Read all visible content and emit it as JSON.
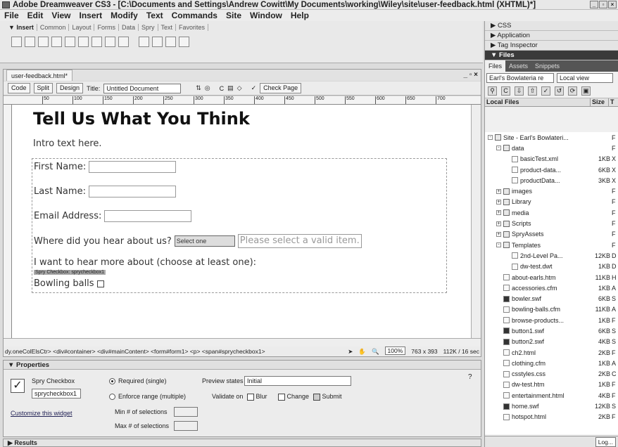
{
  "window": {
    "title": "Adobe Dreamweaver CS3 - [C:\\Documents and Settings\\Andrew Cowitt\\My Documents\\working\\Wiley\\site\\user-feedback.html (XHTML)*]"
  },
  "menu": [
    "File",
    "Edit",
    "View",
    "Insert",
    "Modify",
    "Text",
    "Commands",
    "Site",
    "Window",
    "Help"
  ],
  "insert_bar": {
    "label": "▼ Insert",
    "tabs": [
      "Common",
      "Layout",
      "Forms",
      "Data",
      "Spry",
      "Text",
      "Favorites"
    ]
  },
  "document": {
    "tab": "user-feedback.html*",
    "toolbar": {
      "code": "Code",
      "split": "Split",
      "design": "Design",
      "title_label": "Title:",
      "title_value": "Untitled Document",
      "check_page": "Check Page"
    },
    "ruler_labels": [
      "50",
      "100",
      "150",
      "200",
      "250",
      "300",
      "350",
      "400",
      "450",
      "500",
      "550",
      "600",
      "650",
      "700"
    ],
    "content": {
      "heading": "Tell Us What You Think",
      "intro": "Intro text here.",
      "first_name": "First Name:",
      "last_name": "Last Name:",
      "email": "Email Address:",
      "hear_about": "Where did you hear about us?",
      "select_value": "Select one",
      "select_error": "Please select a valid item.",
      "hear_more": "I want to hear more about (choose at least one):",
      "spry_label": "Spry Checkbox: sprycheckbox1",
      "bowling": "Bowling balls"
    },
    "status": {
      "tags": "dy.oneColElsCtr> <div#container> <div#mainContent> <form#form1> <p> <span#sprycheckbox1>",
      "zoom": "100%",
      "dims": "763 x 393",
      "size": "112K / 16 sec"
    }
  },
  "properties": {
    "header": "▼ Properties",
    "widget_type": "Spry Checkbox",
    "widget_id": "sprycheckbox1",
    "required": "Required (single)",
    "enforce": "Enforce range (multiple)",
    "min_label": "Min # of selections",
    "max_label": "Max # of selections",
    "preview_label": "Preview states",
    "preview_value": "Initial",
    "validate_label": "Validate on",
    "blur": "Blur",
    "change": "Change",
    "submit": "Submit",
    "customize": "Customize this widget"
  },
  "results": "▶ Results",
  "right_panel": {
    "css": "▶ CSS",
    "application": "▶ Application",
    "tag_inspector": "▶ Tag Inspector",
    "files_header": "▼ Files",
    "tabs": [
      "Files",
      "Assets",
      "Snippets"
    ],
    "site_select": "Earl's Bowlateria re",
    "view_select": "Local view",
    "col_local": "Local Files",
    "col_size": "Size",
    "col_type": "T",
    "files": [
      {
        "name": "Site - Earl's Bowlateri...",
        "size": "",
        "type": "F",
        "indent": 0,
        "kind": "folder",
        "exp": "-"
      },
      {
        "name": "data",
        "size": "",
        "type": "F",
        "indent": 1,
        "kind": "folder",
        "exp": "-"
      },
      {
        "name": "basicTest.xml",
        "size": "1KB",
        "type": "X",
        "indent": 2,
        "kind": "file",
        "exp": ""
      },
      {
        "name": "product-data...",
        "size": "6KB",
        "type": "X",
        "indent": 2,
        "kind": "file",
        "exp": ""
      },
      {
        "name": "productData...",
        "size": "3KB",
        "type": "X",
        "indent": 2,
        "kind": "file",
        "exp": ""
      },
      {
        "name": "images",
        "size": "",
        "type": "F",
        "indent": 1,
        "kind": "folder",
        "exp": "+"
      },
      {
        "name": "Library",
        "size": "",
        "type": "F",
        "indent": 1,
        "kind": "folder",
        "exp": "+"
      },
      {
        "name": "media",
        "size": "",
        "type": "F",
        "indent": 1,
        "kind": "folder",
        "exp": "+"
      },
      {
        "name": "Scripts",
        "size": "",
        "type": "F",
        "indent": 1,
        "kind": "folder",
        "exp": "+"
      },
      {
        "name": "SpryAssets",
        "size": "",
        "type": "F",
        "indent": 1,
        "kind": "folder",
        "exp": "+"
      },
      {
        "name": "Templates",
        "size": "",
        "type": "F",
        "indent": 1,
        "kind": "folder",
        "exp": "-"
      },
      {
        "name": "2nd-Level Pa...",
        "size": "12KB",
        "type": "D",
        "indent": 2,
        "kind": "file",
        "exp": ""
      },
      {
        "name": "dw-test.dwt",
        "size": "1KB",
        "type": "D",
        "indent": 2,
        "kind": "file",
        "exp": ""
      },
      {
        "name": "about-earls.htm",
        "size": "11KB",
        "type": "H",
        "indent": 1,
        "kind": "file",
        "exp": ""
      },
      {
        "name": "accessories.cfm",
        "size": "1KB",
        "type": "A",
        "indent": 1,
        "kind": "file",
        "exp": ""
      },
      {
        "name": "bowler.swf",
        "size": "6KB",
        "type": "S",
        "indent": 1,
        "kind": "swf",
        "exp": ""
      },
      {
        "name": "bowling-balls.cfm",
        "size": "11KB",
        "type": "A",
        "indent": 1,
        "kind": "file",
        "exp": ""
      },
      {
        "name": "browse-products...",
        "size": "1KB",
        "type": "F",
        "indent": 1,
        "kind": "file",
        "exp": ""
      },
      {
        "name": "button1.swf",
        "size": "6KB",
        "type": "S",
        "indent": 1,
        "kind": "swf",
        "exp": ""
      },
      {
        "name": "button2.swf",
        "size": "4KB",
        "type": "S",
        "indent": 1,
        "kind": "swf",
        "exp": ""
      },
      {
        "name": "ch2.html",
        "size": "2KB",
        "type": "F",
        "indent": 1,
        "kind": "file",
        "exp": ""
      },
      {
        "name": "clothing.cfm",
        "size": "1KB",
        "type": "A",
        "indent": 1,
        "kind": "file",
        "exp": ""
      },
      {
        "name": "csstyles.css",
        "size": "2KB",
        "type": "C",
        "indent": 1,
        "kind": "file",
        "exp": ""
      },
      {
        "name": "dw-test.htm",
        "size": "1KB",
        "type": "F",
        "indent": 1,
        "kind": "file",
        "exp": ""
      },
      {
        "name": "entertainment.html",
        "size": "4KB",
        "type": "F",
        "indent": 1,
        "kind": "file",
        "exp": ""
      },
      {
        "name": "home.swf",
        "size": "12KB",
        "type": "S",
        "indent": 1,
        "kind": "swf",
        "exp": ""
      },
      {
        "name": "hotspot.html",
        "size": "2KB",
        "type": "F",
        "indent": 1,
        "kind": "file",
        "exp": ""
      }
    ],
    "log_button": "Log..."
  }
}
